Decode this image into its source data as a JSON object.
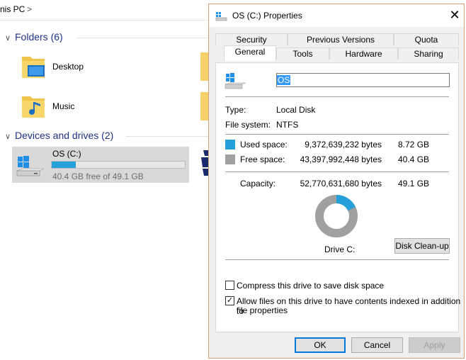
{
  "explorer": {
    "breadcrumb": "nis PC",
    "breadcrumb_chevron": ">",
    "groups": {
      "folders_label": "Folders (6)",
      "devices_label": "Devices and drives (2)"
    },
    "folders": [
      {
        "label": "Desktop",
        "icon": "desktop-folder-icon"
      },
      {
        "label": "Music",
        "icon": "music-folder-icon"
      }
    ],
    "drive": {
      "label": "OS (C:)",
      "free_text": "40.4 GB free of 49.1 GB",
      "used_fraction": 0.18
    }
  },
  "dialog": {
    "title": "OS (C:) Properties",
    "close_glyph": "✕",
    "tabs_row1": [
      "Security",
      "Previous Versions",
      "Quota"
    ],
    "tabs_row2": [
      "General",
      "Tools",
      "Hardware",
      "Sharing"
    ],
    "active_tab": "General",
    "volume_name": "OS",
    "type_label": "Type:",
    "type_value": "Local Disk",
    "fs_label": "File system:",
    "fs_value": "NTFS",
    "used_label": "Used space:",
    "used_bytes": "9,372,639,232 bytes",
    "used_gb": "8.72 GB",
    "free_label": "Free space:",
    "free_bytes": "43,397,992,448 bytes",
    "free_gb": "40.4 GB",
    "capacity_label": "Capacity:",
    "capacity_bytes": "52,770,631,680 bytes",
    "capacity_gb": "49.1 GB",
    "used_fraction": 0.178,
    "drive_label": "Drive C:",
    "cleanup_button": "Disk Clean-up",
    "compress_label": "Compress this drive to save disk space",
    "compress_checked": false,
    "index_label_line1": "Allow files on this drive to have contents indexed in addition to",
    "index_label_line2": "file properties",
    "index_checked": true,
    "ok_button": "OK",
    "cancel_button": "Cancel",
    "apply_button": "Apply",
    "colors": {
      "used": "#26a0da",
      "free": "#a0a0a0",
      "accent_border": "#0078d7"
    }
  }
}
